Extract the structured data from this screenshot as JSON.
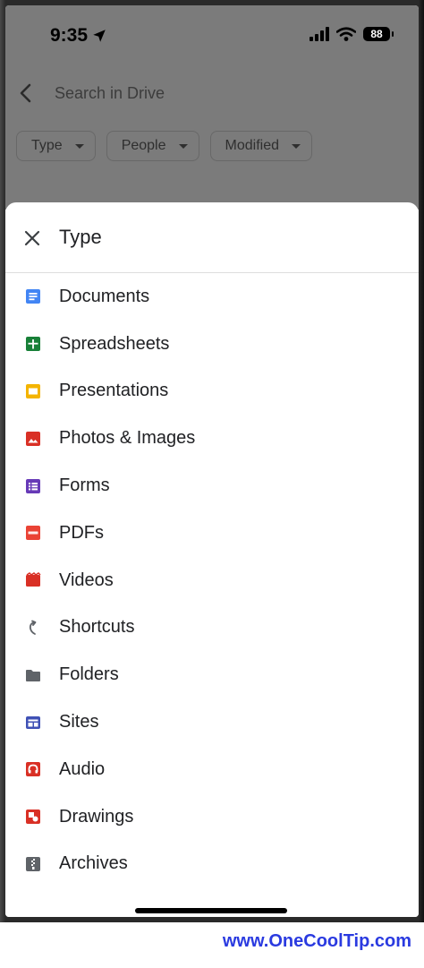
{
  "status_bar": {
    "time": "9:35",
    "battery": "88"
  },
  "search": {
    "placeholder": "Search in Drive"
  },
  "filter_chips": [
    {
      "label": "Type"
    },
    {
      "label": "People"
    },
    {
      "label": "Modified"
    }
  ],
  "sheet": {
    "title": "Type",
    "items": [
      {
        "label": "Documents",
        "icon": "docs-icon",
        "color": "#4285f4"
      },
      {
        "label": "Spreadsheets",
        "icon": "sheets-icon",
        "color": "#188038"
      },
      {
        "label": "Presentations",
        "icon": "slides-icon",
        "color": "#f4b400"
      },
      {
        "label": "Photos & Images",
        "icon": "image-icon",
        "color": "#d93025"
      },
      {
        "label": "Forms",
        "icon": "forms-icon",
        "color": "#673ab7"
      },
      {
        "label": "PDFs",
        "icon": "pdf-icon",
        "color": "#ea4335"
      },
      {
        "label": "Videos",
        "icon": "video-icon",
        "color": "#d93025"
      },
      {
        "label": "Shortcuts",
        "icon": "shortcut-icon",
        "color": "#5f6368"
      },
      {
        "label": "Folders",
        "icon": "folder-icon",
        "color": "#5f6368"
      },
      {
        "label": "Sites",
        "icon": "sites-icon",
        "color": "#3f51b5"
      },
      {
        "label": "Audio",
        "icon": "audio-icon",
        "color": "#d93025"
      },
      {
        "label": "Drawings",
        "icon": "drawings-icon",
        "color": "#d93025"
      },
      {
        "label": "Archives",
        "icon": "archive-icon",
        "color": "#5f6368"
      }
    ]
  },
  "watermark": "www.OneCoolTip.com"
}
